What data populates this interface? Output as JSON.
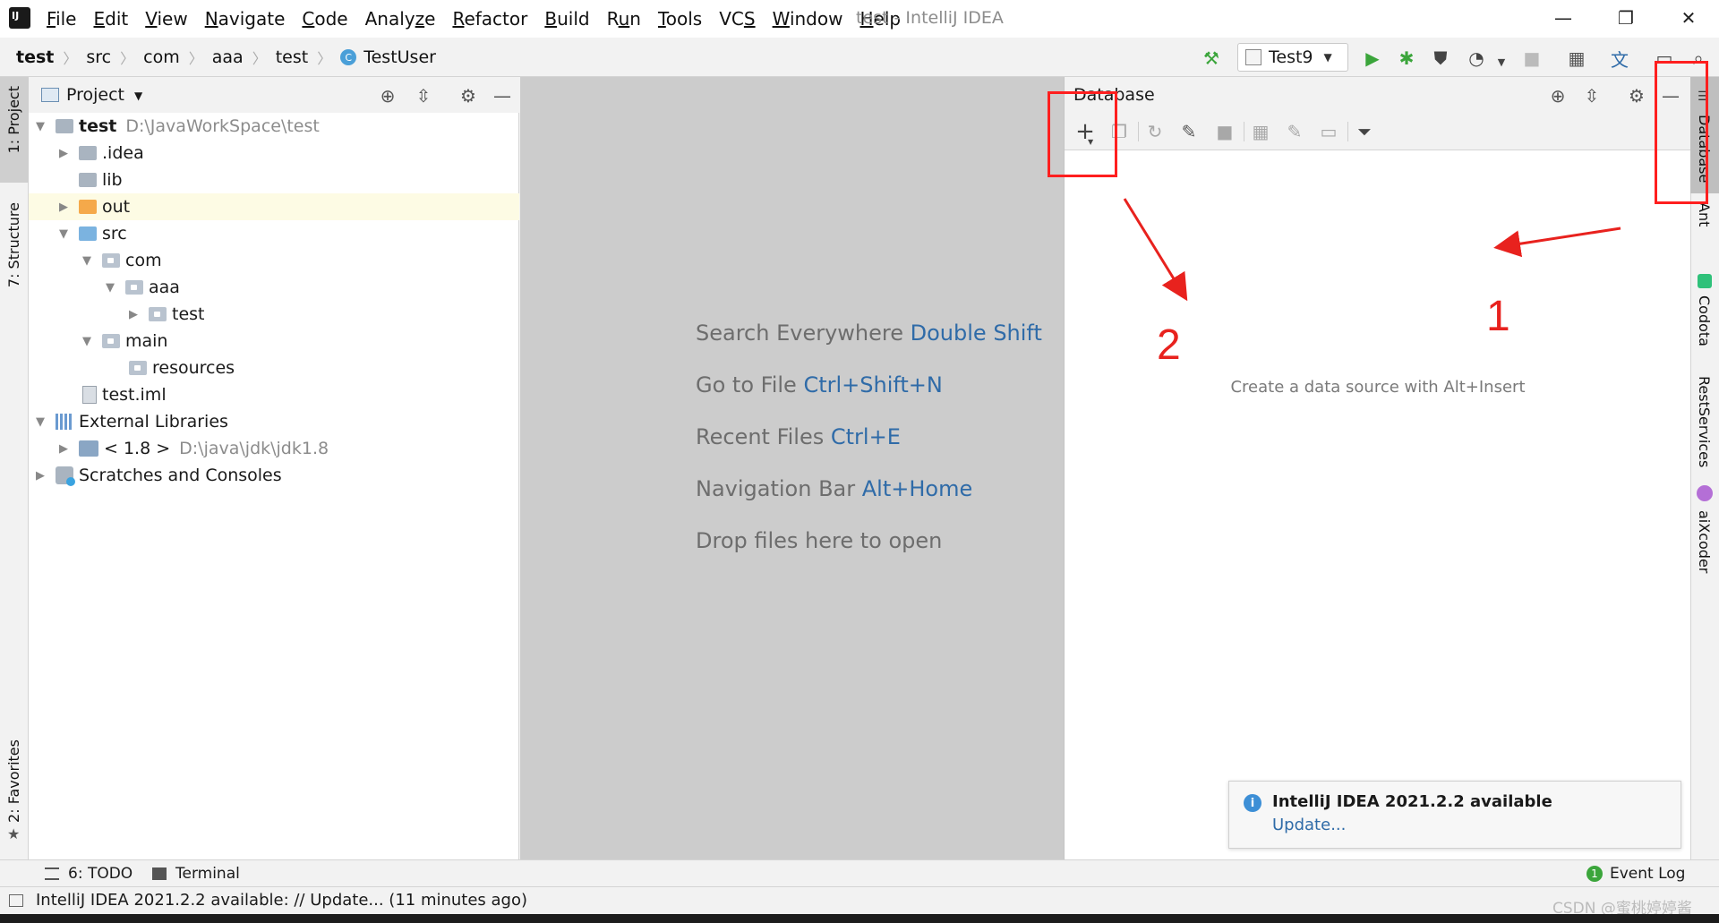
{
  "app": {
    "logo_text": "IJ",
    "window_title": "test - IntelliJ IDEA",
    "menu": [
      {
        "label": "File",
        "mnemonic": "F"
      },
      {
        "label": "Edit",
        "mnemonic": "E"
      },
      {
        "label": "View",
        "mnemonic": "V"
      },
      {
        "label": "Navigate",
        "mnemonic": "N"
      },
      {
        "label": "Code",
        "mnemonic": "C"
      },
      {
        "label": "Analyze",
        "mnemonic": "z"
      },
      {
        "label": "Refactor",
        "mnemonic": "R"
      },
      {
        "label": "Build",
        "mnemonic": "B"
      },
      {
        "label": "Run",
        "mnemonic": "u"
      },
      {
        "label": "Tools",
        "mnemonic": "T"
      },
      {
        "label": "VCS",
        "mnemonic": "S"
      },
      {
        "label": "Window",
        "mnemonic": "W"
      },
      {
        "label": "Help",
        "mnemonic": "H"
      }
    ],
    "window_controls": {
      "minimize": "—",
      "restore": "❐",
      "close": "✕"
    }
  },
  "breadcrumb": [
    "test",
    "src",
    "com",
    "aaa",
    "test",
    "TestUser"
  ],
  "class_icon_letter": "C",
  "run_config": "Test9",
  "left_tabs": {
    "project": "1: Project",
    "structure": "7: Structure",
    "favorites": "2: Favorites"
  },
  "project_panel": {
    "title": "Project",
    "tree": [
      {
        "name": "test",
        "path": "D:\\JavaWorkSpace\\test"
      },
      {
        "name": ".idea"
      },
      {
        "name": "lib"
      },
      {
        "name": "out"
      },
      {
        "name": "src"
      },
      {
        "name": "com"
      },
      {
        "name": "aaa"
      },
      {
        "name": "test"
      },
      {
        "name": "main"
      },
      {
        "name": "resources"
      },
      {
        "name": "test.iml"
      },
      {
        "name": "External Libraries"
      },
      {
        "name": "< 1.8 >",
        "path": "D:\\java\\jdk\\jdk1.8"
      },
      {
        "name": "Scratches and Consoles"
      }
    ]
  },
  "editor_hints": [
    {
      "text": "Search Everywhere",
      "key": "Double Shift"
    },
    {
      "text": "Go to File",
      "key": "Ctrl+Shift+N"
    },
    {
      "text": "Recent Files",
      "key": "Ctrl+E"
    },
    {
      "text": "Navigation Bar",
      "key": "Alt+Home"
    },
    {
      "text": "Drop files here to open",
      "key": ""
    }
  ],
  "database_panel": {
    "title": "Database",
    "empty_text": "Create a data source with Alt+Insert"
  },
  "right_tabs": [
    "Database",
    "Ant",
    "Codota",
    "RestServices",
    "aiXcoder"
  ],
  "notification": {
    "title": "IntelliJ IDEA 2021.2.2 available",
    "link": "Update..."
  },
  "bottom_bar": {
    "todo": "6: TODO",
    "terminal": "Terminal",
    "event_log": "Event Log",
    "event_count": "1"
  },
  "status_text": "IntelliJ IDEA 2021.2.2 available: // Update... (11 minutes ago)",
  "annotations": {
    "num1": "1",
    "num2": "2",
    "color": "#ff1f1f"
  },
  "watermark": "CSDN @蜜桃婷婷酱",
  "colors": {
    "link": "#2f6ba8",
    "editor_bg": "#cccccc",
    "accent_green": "#3ba53b"
  }
}
